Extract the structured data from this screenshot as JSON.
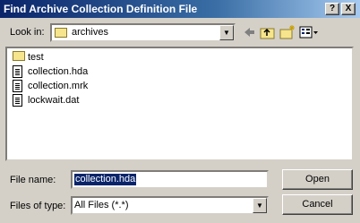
{
  "window": {
    "title": "Find Archive Collection Definition File",
    "help_glyph": "?",
    "close_glyph": "X"
  },
  "look_in": {
    "label": "Look in:",
    "value": "archives"
  },
  "toolbar": {
    "icons": [
      "back-arrow-icon",
      "up-folder-icon",
      "new-folder-icon",
      "view-menu-icon"
    ]
  },
  "files": [
    {
      "name": "test",
      "icon": "folder-icon"
    },
    {
      "name": "collection.hda",
      "icon": "document-icon"
    },
    {
      "name": "collection.mrk",
      "icon": "document-icon"
    },
    {
      "name": "lockwait.dat",
      "icon": "document-icon"
    }
  ],
  "filename": {
    "label": "File name:",
    "value": "collection.hda"
  },
  "filetype": {
    "label": "Files of type:",
    "value": "All Files (*.*)"
  },
  "buttons": {
    "open": "Open",
    "cancel": "Cancel"
  },
  "colors": {
    "title_bar": "#0a246a",
    "face": "#d4d0c8",
    "selection": "#0a246a"
  }
}
